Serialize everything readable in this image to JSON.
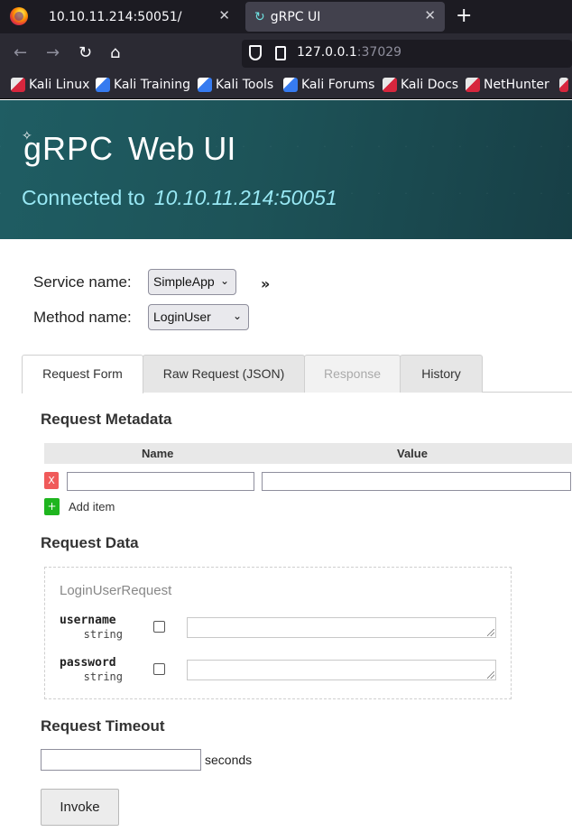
{
  "browser": {
    "tabs": [
      {
        "title": "10.10.11.214:50051/",
        "close": "✕"
      },
      {
        "title": "gRPC UI",
        "close": "✕"
      }
    ],
    "new_tab": "+",
    "url": {
      "host": "127.0.0.1",
      "port": ":37029"
    },
    "bookmarks": [
      "Kali Linux",
      "Kali Training",
      "Kali Tools",
      "Kali Forums",
      "Kali Docs",
      "NetHunter"
    ]
  },
  "header": {
    "logo_text": "gRPC",
    "app_title": "Web UI",
    "connected_label": "Connected to",
    "connected_host": "10.10.11.214:50051"
  },
  "form": {
    "service_label": "Service name:",
    "service_value": "SimpleApp",
    "method_label": "Method name:",
    "method_value": "LoginUser",
    "expand_symbol": "»"
  },
  "tabs": [
    "Request Form",
    "Raw Request (JSON)",
    "Response",
    "History"
  ],
  "metadata": {
    "title": "Request Metadata",
    "col_name": "Name",
    "col_value": "Value",
    "remove_label": "X",
    "add_symbol": "+",
    "add_label": "Add item"
  },
  "request_data": {
    "title": "Request Data",
    "message_type": "LoginUserRequest",
    "fields": [
      {
        "name": "username",
        "type": "string"
      },
      {
        "name": "password",
        "type": "string"
      }
    ]
  },
  "timeout": {
    "title": "Request Timeout",
    "unit": "seconds"
  },
  "invoke_label": "Invoke",
  "colors": {
    "header_bg": "#1d5358",
    "connected_text": "#98e8f4",
    "remove_button": "#f05a5a",
    "add_button": "#1fb51f"
  }
}
